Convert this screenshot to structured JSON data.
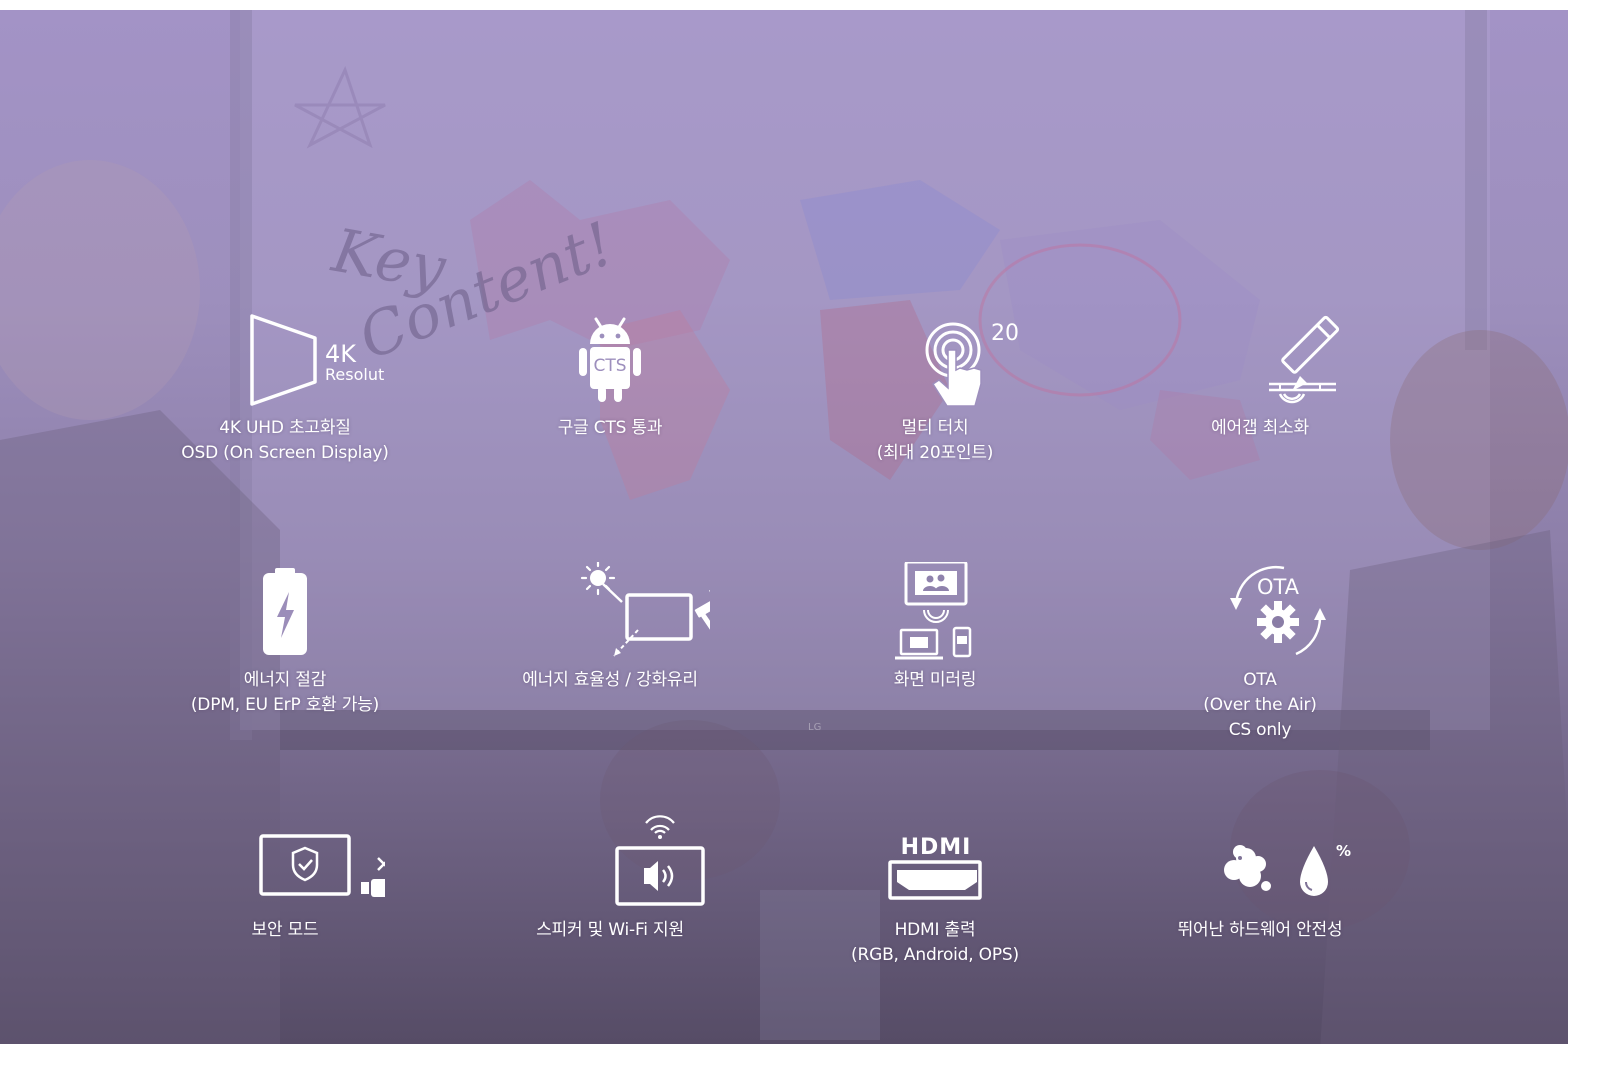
{
  "banner": {
    "background_top": "#a393c6",
    "background_bottom": "#564c66",
    "icon_color": "#ffffff",
    "scene": {
      "whiteboard_text": [
        "Key",
        "Content!"
      ],
      "brand_mark": "LG"
    }
  },
  "features": [
    {
      "icon": "4k-resolution-icon",
      "icon_text": [
        "4K",
        "Resolution"
      ],
      "lines": [
        "4K UHD 초고화질",
        "OSD (On Screen Display)"
      ]
    },
    {
      "icon": "android-cts-icon",
      "icon_text": [
        "CTS"
      ],
      "lines": [
        "구글 CTS 통과"
      ]
    },
    {
      "icon": "multi-touch-icon",
      "icon_text": [
        "20"
      ],
      "lines": [
        "멀티 터치",
        "(최대 20포인트)"
      ]
    },
    {
      "icon": "pen-airgap-icon",
      "icon_text": [],
      "lines": [
        "에어갭 최소화"
      ]
    },
    {
      "icon": "battery-energy-icon",
      "icon_text": [],
      "lines": [
        "에너지 절감",
        "(DPM, EU ErP 호환 가능)"
      ]
    },
    {
      "icon": "tempered-glass-icon",
      "icon_text": [],
      "lines": [
        "에너지 효율성 / 강화유리"
      ]
    },
    {
      "icon": "screen-mirroring-icon",
      "icon_text": [],
      "lines": [
        "화면 미러링"
      ]
    },
    {
      "icon": "ota-update-icon",
      "icon_text": [
        "OTA"
      ],
      "lines": [
        "OTA",
        "(Over the Air)",
        "CS only"
      ]
    },
    {
      "icon": "security-mode-icon",
      "icon_text": [],
      "lines": [
        "보안 모드"
      ]
    },
    {
      "icon": "speaker-wifi-icon",
      "icon_text": [],
      "lines": [
        "스피커 및 Wi-Fi 지원"
      ]
    },
    {
      "icon": "hdmi-out-icon",
      "icon_text": [
        "HDMI"
      ],
      "lines": [
        "HDMI 출력",
        "(RGB, Android, OPS)"
      ]
    },
    {
      "icon": "hardware-durability-icon",
      "icon_text": [
        "%"
      ],
      "lines": [
        "뛰어난 하드웨어 안전성"
      ]
    }
  ]
}
